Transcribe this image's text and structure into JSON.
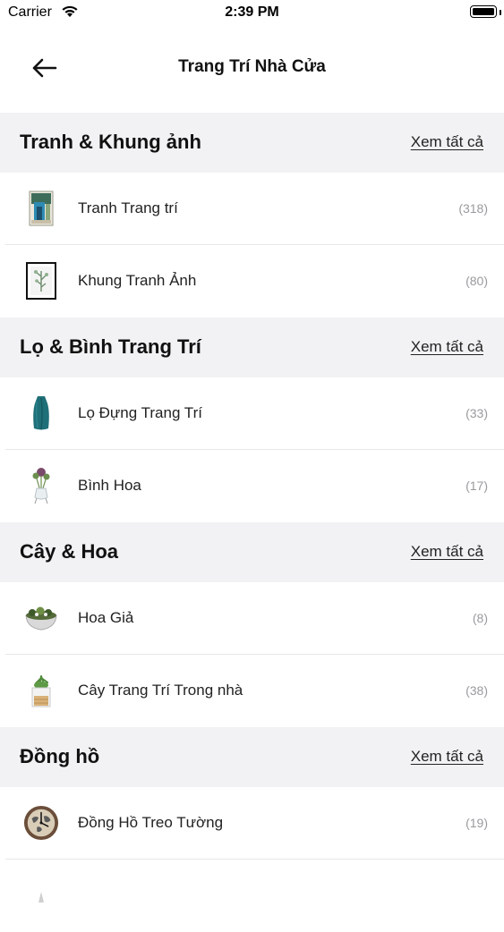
{
  "status": {
    "carrier": "Carrier",
    "time": "2:39 PM"
  },
  "nav": {
    "title": "Trang Trí Nhà Cửa"
  },
  "sections": [
    {
      "title": "Tranh & Khung ảnh",
      "see_all": "Xem tất cả",
      "items": [
        {
          "label": "Tranh Trang trí",
          "count": "(318)",
          "icon": "painting-thumbnail"
        },
        {
          "label": "Khung Tranh Ảnh",
          "count": "(80)",
          "icon": "picture-frame-thumbnail"
        }
      ]
    },
    {
      "title": "Lọ & Bình Trang Trí",
      "see_all": "Xem tất cả",
      "items": [
        {
          "label": "Lọ Đựng Trang Trí",
          "count": "(33)",
          "icon": "vase-thumbnail"
        },
        {
          "label": "Bình Hoa",
          "count": "(17)",
          "icon": "flower-vase-thumbnail"
        }
      ]
    },
    {
      "title": "Cây & Hoa",
      "see_all": "Xem tất cả",
      "items": [
        {
          "label": "Hoa Giả",
          "count": "(8)",
          "icon": "artificial-flower-thumbnail"
        },
        {
          "label": "Cây Trang Trí Trong nhà",
          "count": "(38)",
          "icon": "potted-plant-thumbnail"
        }
      ]
    },
    {
      "title": "Đồng hồ",
      "see_all": "Xem tất cả",
      "items": [
        {
          "label": "Đồng Hồ Treo Tường",
          "count": "(19)",
          "icon": "wall-clock-thumbnail"
        }
      ]
    }
  ]
}
